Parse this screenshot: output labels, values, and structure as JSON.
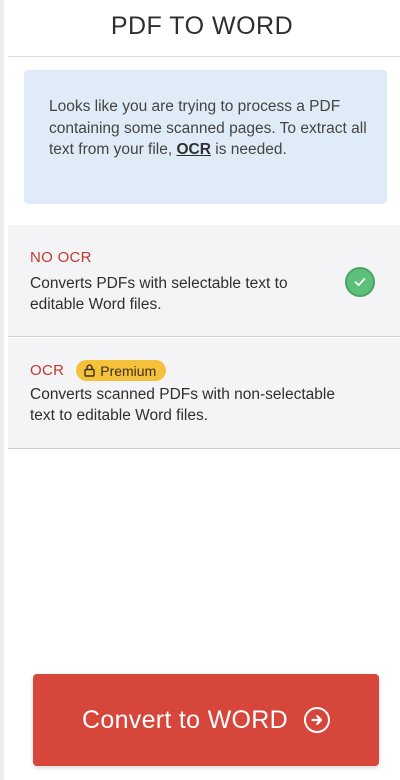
{
  "header": {
    "title": "PDF TO WORD"
  },
  "notice": {
    "text_before": "Looks like you are trying to process a PDF containing some scanned pages. To extract all text from your file, ",
    "link_text": "OCR",
    "text_after": " is needed."
  },
  "options": [
    {
      "title": "NO OCR",
      "description": "Converts PDFs with selectable text to editable Word files.",
      "selected": true,
      "icon": "check-circle-icon"
    },
    {
      "title": "OCR",
      "badge": "Premium",
      "badge_icon": "lock-icon",
      "description": "Converts scanned PDFs with non-selectable text to editable Word files.",
      "selected": false
    }
  ],
  "action": {
    "label": "Convert to WORD",
    "icon": "arrow-right-circle-icon"
  },
  "colors": {
    "accent_red": "#d6463a",
    "option_title_red": "#c0392b",
    "notice_bg": "#dfebf6",
    "option_bg": "#f4f4f6",
    "badge_yellow": "#f5c13a",
    "check_green": "#5cc07a"
  }
}
